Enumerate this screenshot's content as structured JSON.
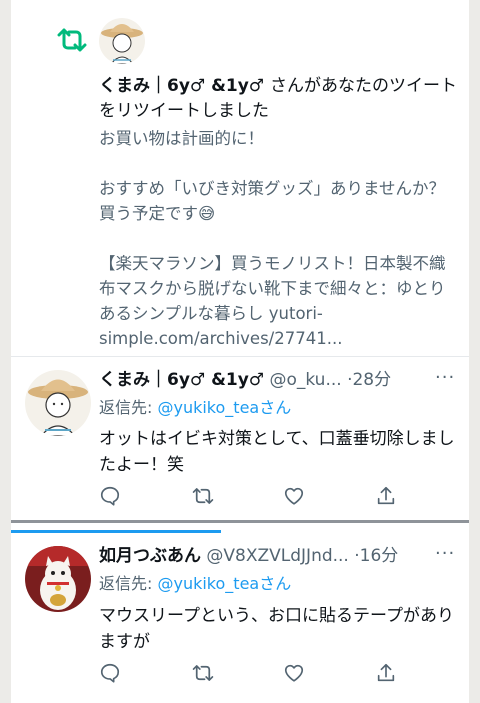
{
  "notification": {
    "retweeter_name": "くまみ｜6y♂ &1y♂",
    "action_text": "さんがあなたのツイートをリツイートしました",
    "tweet_lines": [
      "お買い物は計画的に！",
      "おすすめ「いびき対策グッズ」ありませんか？買う予定です😅",
      "【楽天マラソン】買うモノリスト！日本製不織布マスクから脱げない靴下まで細々と：ゆとりあるシンプルな暮らし yutori-simple.com/archives/27741..."
    ]
  },
  "replies": [
    {
      "name": "くまみ｜6y♂ &1y♂",
      "handle": "@o_ku...",
      "time": "·28分",
      "reply_label": "返信先: ",
      "reply_user": "@yukiko_tea",
      "reply_suffix": "さん",
      "text": "オットはイビキ対策として、口蓋垂切除しましたよー！笑",
      "more": "···"
    },
    {
      "name": "如月つぶあん",
      "handle": "@V8XZVLdJJnd...",
      "time": "·16分",
      "reply_label": "返信先: ",
      "reply_user": "@yukiko_tea",
      "reply_suffix": "さん",
      "text": "マウスリープという、お口に貼るテープがありますが",
      "more": "···"
    }
  ],
  "colors": {
    "accent": "#1d9bf0",
    "retweet": "#00ba7c",
    "muted": "#536471"
  }
}
